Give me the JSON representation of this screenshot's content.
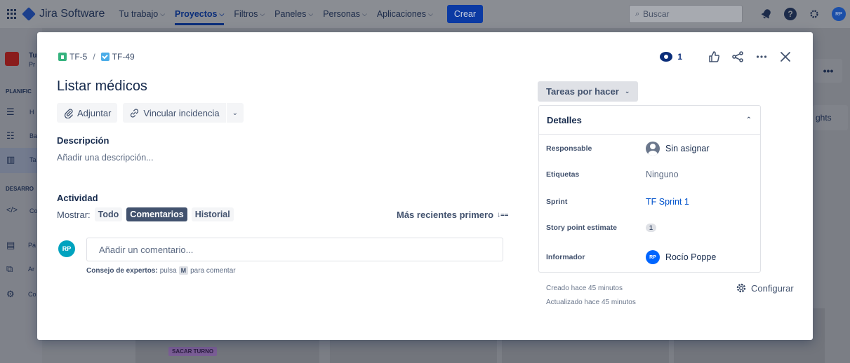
{
  "app": {
    "brand": "Jira Software",
    "nav": [
      {
        "label": "Tu trabajo",
        "active": false
      },
      {
        "label": "Proyectos",
        "active": true
      },
      {
        "label": "Filtros",
        "active": false
      },
      {
        "label": "Paneles",
        "active": false
      },
      {
        "label": "Personas",
        "active": false
      },
      {
        "label": "Aplicaciones",
        "active": false
      }
    ],
    "create_label": "Crear",
    "search_placeholder": "Buscar",
    "avatar_initials": "RP"
  },
  "background": {
    "sidebar_project_initial": "Tu",
    "sidebar_project_sub": "Pr",
    "section_planning": "PLANIFIC",
    "section_dev": "DESARRO",
    "items": [
      "H",
      "Ba",
      "Ta",
      "Co",
      "Pá",
      "Ar",
      "Co"
    ],
    "card_tag": "SACAR TURNO",
    "insights_label": "ghts",
    "more_label": "•••"
  },
  "issue": {
    "breadcrumb": [
      {
        "key": "TF-5",
        "type": "story"
      },
      {
        "key": "TF-49",
        "type": "task"
      }
    ],
    "breadcrumb_sep": "/",
    "watch_count": "1",
    "title": "Listar médicos",
    "actions": {
      "attach": "Adjuntar",
      "link": "Vincular incidencia"
    },
    "description_label": "Descripción",
    "description_placeholder": "Añadir una descripción...",
    "activity_label": "Actividad",
    "show_label": "Mostrar:",
    "filters": [
      {
        "label": "Todo",
        "selected": false
      },
      {
        "label": "Comentarios",
        "selected": true
      },
      {
        "label": "Historial",
        "selected": false
      }
    ],
    "sort_label": "Más recientes primero",
    "comment_avatar": "RP",
    "comment_placeholder": "Añadir un comentario...",
    "tip_bold": "Consejo de expertos:",
    "tip_pre": "pulsa",
    "tip_key": "M",
    "tip_post": "para comentar"
  },
  "sidebar_panel": {
    "status": "Tareas por hacer",
    "details_title": "Detalles",
    "fields": [
      {
        "label": "Responsable",
        "value": "Sin asignar"
      },
      {
        "label": "Etiquetas",
        "value": "Ninguno"
      },
      {
        "label": "Sprint",
        "value": "TF Sprint 1"
      },
      {
        "label": "Story point estimate",
        "value": "1"
      },
      {
        "label": "Informador",
        "value": "Rocío Poppe",
        "avatar": "RP"
      }
    ],
    "created": "Creado hace 45 minutos",
    "updated": "Actualizado hace 45 minutos",
    "configure": "Configurar"
  },
  "colors": {
    "brand_blue": "#0052cc",
    "selected_chip": "#42526e",
    "avatar_teal": "#00a3bf"
  }
}
